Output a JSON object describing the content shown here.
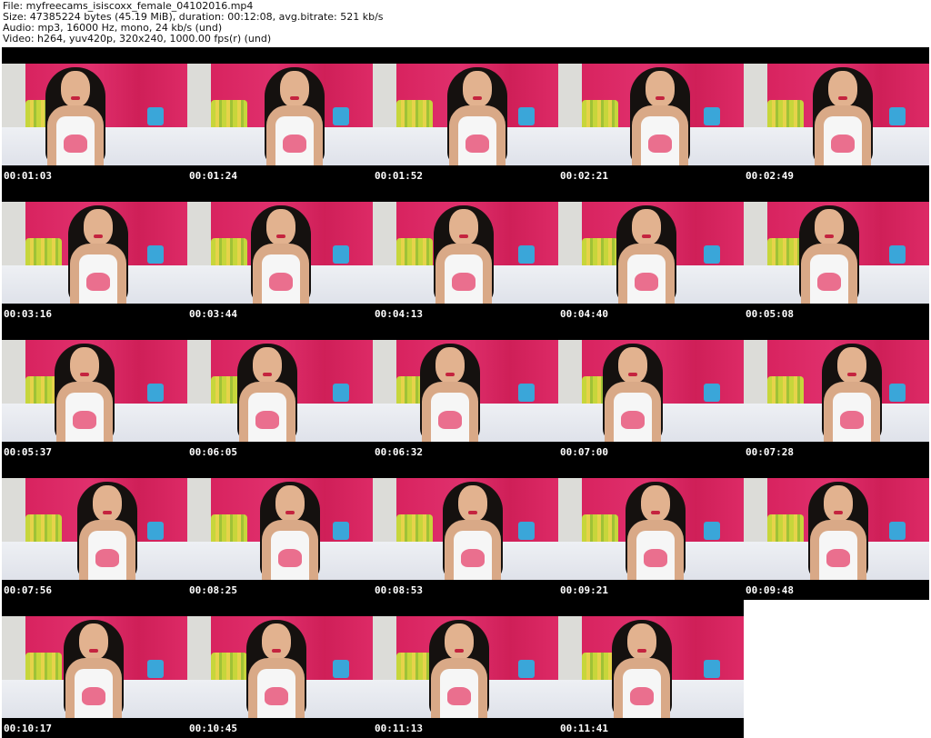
{
  "header": {
    "file_line": "File: myfreecams_isiscoxx_female_04102016.mp4",
    "size_line": "Size: 47385224 bytes (45.19 MiB), duration: 00:12:08, avg.bitrate: 521 kb/s",
    "audio_line": "Audio: mp3, 16000 Hz, mono, 24 kb/s (und)",
    "video_line": "Video: h264, yuv420p, 320x240, 1000.00 fps(r) (und)"
  },
  "thumbnails": [
    {
      "timestamp": "00:01:03"
    },
    {
      "timestamp": "00:01:24"
    },
    {
      "timestamp": "00:01:52"
    },
    {
      "timestamp": "00:02:21"
    },
    {
      "timestamp": "00:02:49"
    },
    {
      "timestamp": "00:03:16"
    },
    {
      "timestamp": "00:03:44"
    },
    {
      "timestamp": "00:04:13"
    },
    {
      "timestamp": "00:04:40"
    },
    {
      "timestamp": "00:05:08"
    },
    {
      "timestamp": "00:05:37"
    },
    {
      "timestamp": "00:06:05"
    },
    {
      "timestamp": "00:06:32"
    },
    {
      "timestamp": "00:07:00"
    },
    {
      "timestamp": "00:07:28"
    },
    {
      "timestamp": "00:07:56"
    },
    {
      "timestamp": "00:08:25"
    },
    {
      "timestamp": "00:08:53"
    },
    {
      "timestamp": "00:09:21"
    },
    {
      "timestamp": "00:09:48"
    },
    {
      "timestamp": "00:10:17"
    },
    {
      "timestamp": "00:10:45"
    },
    {
      "timestamp": "00:11:13"
    },
    {
      "timestamp": "00:11:41"
    }
  ]
}
